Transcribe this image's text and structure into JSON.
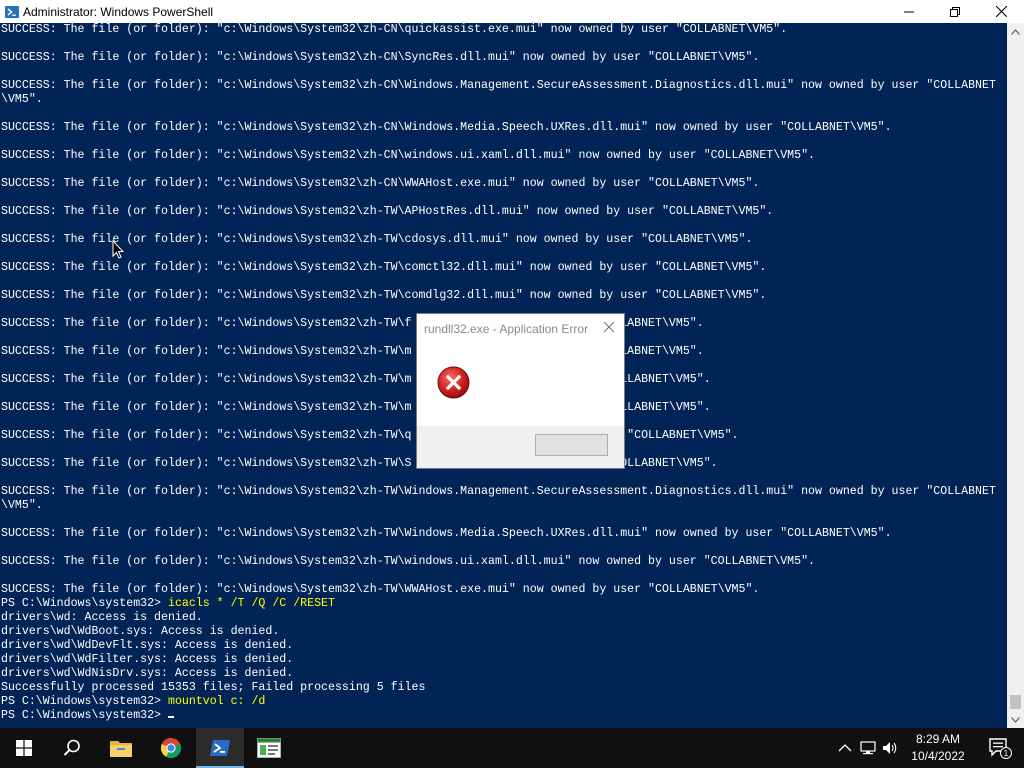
{
  "window": {
    "title": "Administrator: Windows PowerShell"
  },
  "console": {
    "lines": [
      {
        "text": "SUCCESS: The file (or folder): \"c:\\Windows\\System32\\zh-CN\\quickassist.exe.mui\" now owned by user \"COLLABNET\\VM5\"."
      },
      {
        "text": ""
      },
      {
        "text": "SUCCESS: The file (or folder): \"c:\\Windows\\System32\\zh-CN\\SyncRes.dll.mui\" now owned by user \"COLLABNET\\VM5\"."
      },
      {
        "text": ""
      },
      {
        "text": "SUCCESS: The file (or folder): \"c:\\Windows\\System32\\zh-CN\\Windows.Management.SecureAssessment.Diagnostics.dll.mui\" now owned by user \"COLLABNET"
      },
      {
        "text": "\\VM5\"."
      },
      {
        "text": ""
      },
      {
        "text": "SUCCESS: The file (or folder): \"c:\\Windows\\System32\\zh-CN\\Windows.Media.Speech.UXRes.dll.mui\" now owned by user \"COLLABNET\\VM5\"."
      },
      {
        "text": ""
      },
      {
        "text": "SUCCESS: The file (or folder): \"c:\\Windows\\System32\\zh-CN\\windows.ui.xaml.dll.mui\" now owned by user \"COLLABNET\\VM5\"."
      },
      {
        "text": ""
      },
      {
        "text": "SUCCESS: The file (or folder): \"c:\\Windows\\System32\\zh-CN\\WWAHost.exe.mui\" now owned by user \"COLLABNET\\VM5\"."
      },
      {
        "text": ""
      },
      {
        "text": "SUCCESS: The file (or folder): \"c:\\Windows\\System32\\zh-TW\\APHostRes.dll.mui\" now owned by user \"COLLABNET\\VM5\"."
      },
      {
        "text": ""
      },
      {
        "text": "SUCCESS: The file (or folder): \"c:\\Windows\\System32\\zh-TW\\cdosys.dll.mui\" now owned by user \"COLLABNET\\VM5\"."
      },
      {
        "text": ""
      },
      {
        "text": "SUCCESS: The file (or folder): \"c:\\Windows\\System32\\zh-TW\\comctl32.dll.mui\" now owned by user \"COLLABNET\\VM5\"."
      },
      {
        "text": ""
      },
      {
        "text": "SUCCESS: The file (or folder): \"c:\\Windows\\System32\\zh-TW\\comdlg32.dll.mui\" now owned by user \"COLLABNET\\VM5\"."
      },
      {
        "text": ""
      },
      {
        "text": "SUCCESS: The file (or folder): \"c:\\Windows\\System32\\zh-TW\\f                          \"COLLABNET\\VM5\"."
      },
      {
        "text": ""
      },
      {
        "text": "SUCCESS: The file (or folder): \"c:\\Windows\\System32\\zh-TW\\m                        r \"COLLABNET\\VM5\"."
      },
      {
        "text": ""
      },
      {
        "text": "SUCCESS: The file (or folder): \"c:\\Windows\\System32\\zh-TW\\m                        er \"COLLABNET\\VM5\"."
      },
      {
        "text": ""
      },
      {
        "text": "SUCCESS: The file (or folder): \"c:\\Windows\\System32\\zh-TW\\m                        er \"COLLABNET\\VM5\"."
      },
      {
        "text": ""
      },
      {
        "text": "SUCCESS: The file (or folder): \"c:\\Windows\\System32\\zh-TW\\q                        y user \"COLLABNET\\VM5\"."
      },
      {
        "text": ""
      },
      {
        "text": "SUCCESS: The file (or folder): \"c:\\Windows\\System32\\zh-TW\\S                        ser \"COLLABNET\\VM5\"."
      },
      {
        "text": ""
      },
      {
        "text": "SUCCESS: The file (or folder): \"c:\\Windows\\System32\\zh-TW\\Windows.Management.SecureAssessment.Diagnostics.dll.mui\" now owned by user \"COLLABNET"
      },
      {
        "text": "\\VM5\"."
      },
      {
        "text": ""
      },
      {
        "text": "SUCCESS: The file (or folder): \"c:\\Windows\\System32\\zh-TW\\Windows.Media.Speech.UXRes.dll.mui\" now owned by user \"COLLABNET\\VM5\"."
      },
      {
        "text": ""
      },
      {
        "text": "SUCCESS: The file (or folder): \"c:\\Windows\\System32\\zh-TW\\windows.ui.xaml.dll.mui\" now owned by user \"COLLABNET\\VM5\"."
      },
      {
        "text": ""
      },
      {
        "text": "SUCCESS: The file (or folder): \"c:\\Windows\\System32\\zh-TW\\WWAHost.exe.mui\" now owned by user \"COLLABNET\\VM5\"."
      },
      {
        "text": "PS C:\\Windows\\system32> ",
        "cmd": "icacls * /T /Q /C /RESET"
      },
      {
        "text": "drivers\\wd: Access is denied."
      },
      {
        "text": "drivers\\wd\\WdBoot.sys: Access is denied."
      },
      {
        "text": "drivers\\wd\\WdDevFlt.sys: Access is denied."
      },
      {
        "text": "drivers\\wd\\WdFilter.sys: Access is denied."
      },
      {
        "text": "drivers\\wd\\WdNisDrv.sys: Access is denied."
      },
      {
        "text": "Successfully processed 15353 files; Failed processing 5 files"
      },
      {
        "text": "PS C:\\Windows\\system32> ",
        "cmd": "mountvol c: /d"
      },
      {
        "text": "PS C:\\Windows\\system32> ",
        "cursor": true
      }
    ]
  },
  "dialog": {
    "title": "rundll32.exe - Application Error"
  },
  "taskbar": {
    "items": [
      "start-icon",
      "search-icon",
      "file-explorer-icon",
      "chrome-icon",
      "powershell-icon",
      "server-manager-icon"
    ],
    "time": "8:29 AM",
    "date": "10/4/2022",
    "notification_count": "1"
  },
  "colors": {
    "console_bg": "#012456",
    "command": "#ffff00",
    "taskbar": "#101010"
  }
}
